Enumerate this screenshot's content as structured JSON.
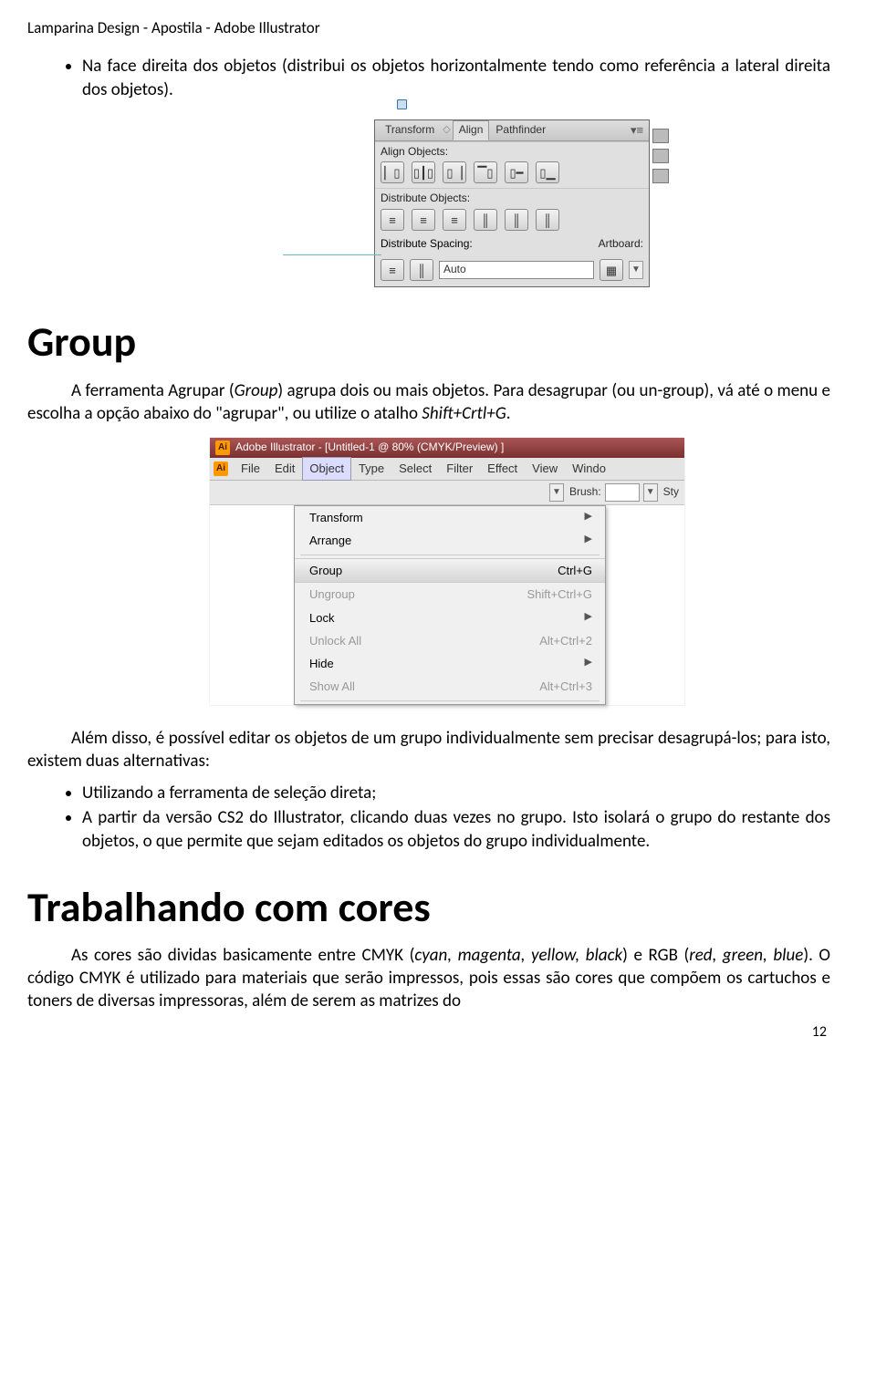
{
  "header": "Lamparina Design - Apostila - Adobe Illustrator",
  "intro_bullet": "Na face direita dos objetos (distribui os objetos horizontalmente tendo como referência a lateral direita dos objetos).",
  "align_panel": {
    "tab_transform": "Transform",
    "tab_align": "Align",
    "tab_pathfinder": "Pathfinder",
    "sec_align": "Align Objects:",
    "sec_distribute": "Distribute Objects:",
    "sec_spacing": "Distribute Spacing:",
    "auto": "Auto",
    "artboard": "Artboard:"
  },
  "section_group": "Group",
  "group_p1a": "A ferramenta Agrupar (",
  "group_p1_italic": "Group",
  "group_p1b": ") agrupa dois ou mais objetos. Para desagrupar (ou un-group), vá até o menu e escolha a opção abaixo do \"agrupar\", ou utilize o atalho ",
  "group_p1_italic2": "Shift+Crtl+G",
  "group_p1c": ".",
  "menu_fig": {
    "title": "Adobe Illustrator - [Untitled-1 @ 80% (CMYK/Preview) ]",
    "menus": {
      "file": "File",
      "edit": "Edit",
      "object": "Object",
      "type": "Type",
      "select": "Select",
      "filter": "Filter",
      "effect": "Effect",
      "view": "View",
      "window": "Windo"
    },
    "brush_label": "Brush:",
    "sty": "Sty",
    "items": {
      "transform": "Transform",
      "arrange": "Arrange",
      "group": "Group",
      "group_sc": "Ctrl+G",
      "ungroup": "Ungroup",
      "ungroup_sc": "Shift+Ctrl+G",
      "lock": "Lock",
      "unlock": "Unlock All",
      "unlock_sc": "Alt+Ctrl+2",
      "hide": "Hide",
      "show": "Show All",
      "show_sc": "Alt+Ctrl+3"
    }
  },
  "group_p2": "Além disso, é possível editar os objetos de um grupo individualmente sem precisar desagrupá-los; para isto, existem duas alternativas:",
  "bullet2a": "Utilizando a ferramenta de seleção direta;",
  "bullet2b": "A partir da versão CS2 do Illustrator, clicando duas vezes no grupo. Isto isolará o grupo do restante dos objetos, o que permite que sejam editados os objetos do grupo individualmente.",
  "section_colors": "Trabalhando com cores",
  "colors_p_a": "As cores são dividas basicamente entre CMYK (",
  "colors_p_italic1": "cyan, magenta, yellow, black",
  "colors_p_b": ") e RGB (",
  "colors_p_italic2": "red, green, blue",
  "colors_p_c": "). O código CMYK é utilizado para materiais que serão impressos, pois essas são cores que compõem os cartuchos e toners de diversas impressoras, além de serem as matrizes do",
  "pagenum": "12"
}
